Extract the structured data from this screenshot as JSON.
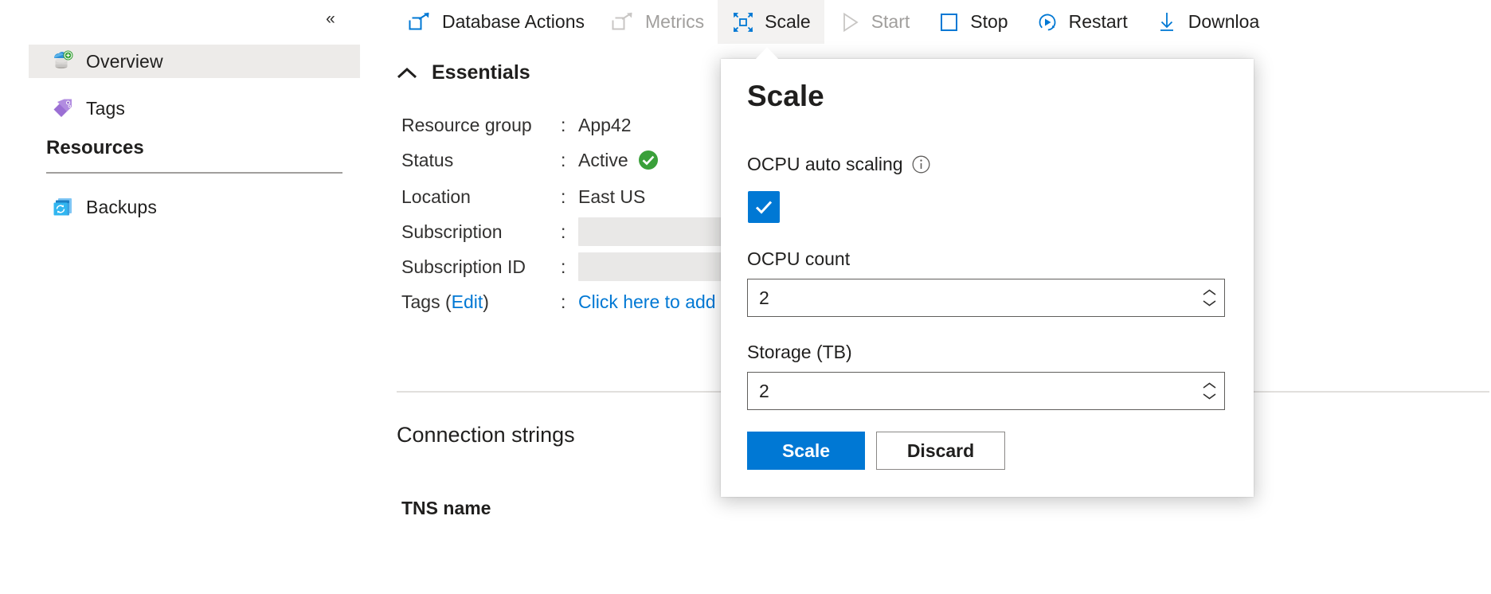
{
  "left_nav": {
    "collapse_label": "«",
    "items": [
      {
        "label": "Overview",
        "icon": "database-overview-icon",
        "selected": true
      },
      {
        "label": "Tags",
        "icon": "tag-icon",
        "selected": false
      }
    ],
    "section_title": "Resources",
    "resource_items": [
      {
        "label": "Backups",
        "icon": "backups-icon",
        "selected": false
      }
    ]
  },
  "command_bar": {
    "items": [
      {
        "label": "Database Actions",
        "icon": "open-in-new-icon",
        "state": "enabled"
      },
      {
        "label": "Metrics",
        "icon": "open-in-new-icon",
        "state": "disabled"
      },
      {
        "label": "Scale",
        "icon": "scale-expand-icon",
        "state": "active"
      },
      {
        "label": "Start",
        "icon": "play-icon",
        "state": "disabled"
      },
      {
        "label": "Stop",
        "icon": "stop-square-icon",
        "state": "enabled"
      },
      {
        "label": "Restart",
        "icon": "restart-icon",
        "state": "enabled"
      },
      {
        "label": "Downloa",
        "icon": "download-icon",
        "state": "enabled"
      }
    ]
  },
  "essentials": {
    "title": "Essentials",
    "chevron": "chevron-up-icon",
    "rows": [
      {
        "key": "Resource group",
        "colon": ":",
        "value": "App42",
        "type": "text"
      },
      {
        "key": "Status",
        "colon": ":",
        "value": "Active",
        "type": "status",
        "status_icon": "green-check-icon"
      },
      {
        "key": "Location",
        "colon": ":",
        "value": "East US",
        "type": "text"
      },
      {
        "key": "Subscription",
        "colon": ":",
        "value": "",
        "type": "redacted"
      },
      {
        "key": "Subscription ID",
        "colon": ":",
        "value": "",
        "type": "redacted"
      },
      {
        "key": "Tags (Edit)",
        "colon": ":",
        "value": "Click here to add",
        "type": "link",
        "edit_label": "Edit"
      }
    ]
  },
  "connection_strings": {
    "heading": "Connection strings",
    "tns_name_label": "TNS name"
  },
  "scale_flyout": {
    "title": "Scale",
    "autoscale": {
      "label": "OCPU auto scaling",
      "info_icon": "info-icon",
      "checked": true
    },
    "fields": [
      {
        "label": "OCPU count",
        "value": "2",
        "name": "ocpu-count"
      },
      {
        "label": "Storage (TB)",
        "value": "2",
        "name": "storage-tb"
      }
    ],
    "primary_button": "Scale",
    "secondary_button": "Discard"
  },
  "colors": {
    "accent": "#0078d4",
    "success": "#107c10",
    "disabled_text": "#a19f9d",
    "selected_bg": "#edebe9",
    "redacted_bg": "#e9e8e7"
  }
}
